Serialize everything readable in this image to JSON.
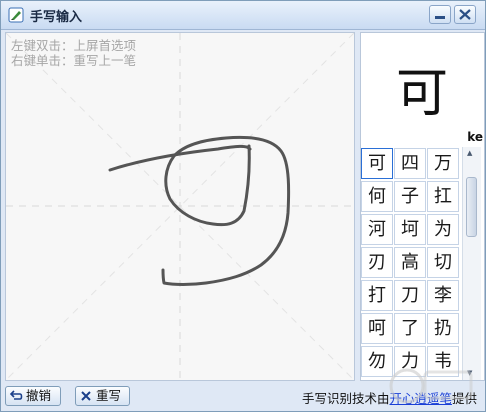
{
  "window": {
    "title": "手写输入"
  },
  "colors": {
    "accent": "#2a6fd6",
    "hint": "#a6a6a6",
    "link": "#1a3fd6",
    "stroke": "#555555"
  },
  "pad": {
    "hint_line1": "左键双击：上屏首选项",
    "hint_line2": "右键单击：重写上一笔"
  },
  "preview": {
    "char": "可",
    "pinyin": "ke"
  },
  "candidates": [
    [
      "可",
      "四",
      "万"
    ],
    [
      "何",
      "子",
      "扛"
    ],
    [
      "河",
      "坷",
      "为"
    ],
    [
      "刃",
      "高",
      "切"
    ],
    [
      "打",
      "刀",
      "李"
    ],
    [
      "呵",
      "了",
      "扔"
    ],
    [
      "勿",
      "力",
      "韦"
    ]
  ],
  "buttons": {
    "undo": "撤销",
    "rewrite": "重写"
  },
  "credit": {
    "prefix": "手写识别技术由",
    "link": "开心逍遥笔",
    "suffix": "提供"
  },
  "icons": {
    "title": "pen-icon",
    "minimize": "minimize-icon",
    "close": "close-icon",
    "undo": "undo-icon",
    "rewrite": "clear-icon"
  }
}
